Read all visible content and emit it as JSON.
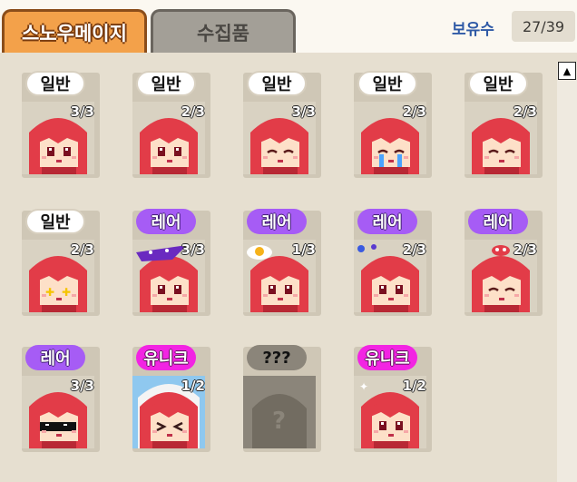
{
  "tabs": [
    {
      "label": "스노우메이지",
      "active": true
    },
    {
      "label": "수집품",
      "active": false
    }
  ],
  "owned": {
    "label": "보유수",
    "count": "27/39"
  },
  "cards": [
    {
      "rarity": "일반",
      "kind": "common",
      "count": "3/3",
      "accessory": "none",
      "eyes": "normal"
    },
    {
      "rarity": "일반",
      "kind": "common",
      "count": "2/3",
      "accessory": "none",
      "eyes": "normal"
    },
    {
      "rarity": "일반",
      "kind": "common",
      "count": "3/3",
      "accessory": "none",
      "eyes": "closed"
    },
    {
      "rarity": "일반",
      "kind": "common",
      "count": "2/3",
      "accessory": "none",
      "eyes": "crying"
    },
    {
      "rarity": "일반",
      "kind": "common",
      "count": "2/3",
      "accessory": "none",
      "eyes": "closed"
    },
    {
      "rarity": "일반",
      "kind": "common",
      "count": "2/3",
      "accessory": "none",
      "eyes": "star"
    },
    {
      "rarity": "레어",
      "kind": "rare",
      "count": "3/3",
      "accessory": "wizard-hat",
      "eyes": "normal"
    },
    {
      "rarity": "레어",
      "kind": "rare",
      "count": "1/3",
      "accessory": "fried-egg",
      "eyes": "normal"
    },
    {
      "rarity": "레어",
      "kind": "rare",
      "count": "2/3",
      "accessory": "hairpins",
      "eyes": "normal"
    },
    {
      "rarity": "레어",
      "kind": "rare",
      "count": "2/3",
      "accessory": "mushroom-pin",
      "eyes": "closed"
    },
    {
      "rarity": "레어",
      "kind": "rare",
      "count": "3/3",
      "accessory": "sunglasses",
      "eyes": "sunglasses"
    },
    {
      "rarity": "유니크",
      "kind": "unique",
      "count": "1/2",
      "accessory": "snow-hood",
      "eyes": "squint"
    },
    {
      "rarity": "???",
      "kind": "unknown",
      "count": "",
      "accessory": "question-mark",
      "eyes": "none"
    },
    {
      "rarity": "유니크",
      "kind": "unique",
      "count": "1/2",
      "accessory": "sparkles",
      "eyes": "normal"
    }
  ],
  "colors": {
    "hair": "#e23c48",
    "skin": "#fde0c8",
    "common": "#ffffff",
    "rare": "#a65cf5",
    "unique": "#f224e3",
    "unknown": "#8b857a"
  }
}
